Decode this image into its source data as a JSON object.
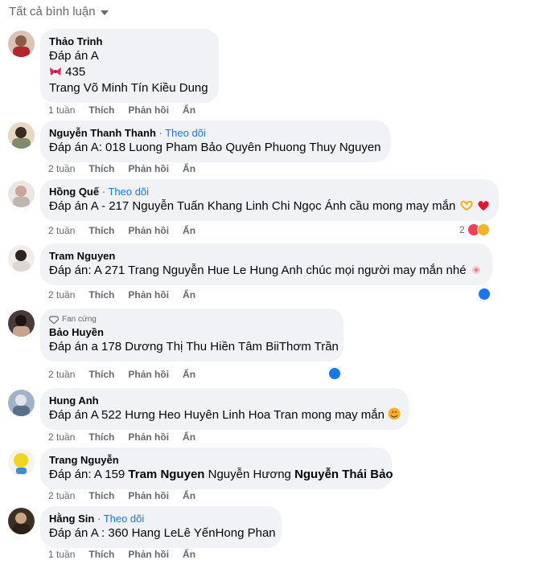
{
  "header": {
    "label": "Tất cả bình luận"
  },
  "actions": {
    "like": "Thích",
    "reply": "Phản hồi",
    "hide": "Ẩn"
  },
  "follow_label": "Theo dõi",
  "comments": [
    {
      "name": "Thảo Trinh",
      "lines": [
        "Đáp án A",
        "435",
        "Trang Võ Minh Tín Kiều Dung"
      ],
      "time": "1 tuần"
    },
    {
      "name": "Nguyễn Thanh Thanh",
      "lines": [
        "Đáp án A: 018",
        "Luong Pham Bảo Quyên Phuong Thuy Nguyen"
      ],
      "time": "2 tuần"
    },
    {
      "name": "Hồng Quế",
      "lines": [
        "Đáp án A - 217",
        "Nguyễn Tuấn Khang Linh Chi Ngọc Ánh",
        "cầu mong may mắn"
      ],
      "time": "2 tuần",
      "reaction_count": "2"
    },
    {
      "name": "Tram Nguyen",
      "lines": [
        "Đáp án: A 271",
        "Trang Nguyễn Hue Le Hung Anh",
        "chúc mọi người may mắn nhé"
      ],
      "time": "2 tuần"
    },
    {
      "badge": "Fan cứng",
      "name": "Bảo Huyền",
      "lines": [
        "Đáp án a 178 Dương Thị Thu Hiền Tâm BiiThơm Trần"
      ],
      "time": "2 tuần"
    },
    {
      "name": "Hung Anh",
      "lines": [
        "Đáp án A 522",
        "Hưng Heo Huyên Linh Hoa Tran",
        "mong may mắn"
      ],
      "time": "2 tuần"
    },
    {
      "name": "Trang Nguyễn",
      "lines": [
        "Đáp án: A 159",
        "Tram Nguyen",
        "Nguyễn Hương",
        "Nguyễn Thái Bảo"
      ],
      "time": "2 tuần"
    },
    {
      "name": "Hằng Sin",
      "lines": [
        "Đáp án A : 360 Hang LeLê YếnHong Phan"
      ],
      "time": "1 tuần"
    }
  ],
  "icons": {
    "dropdown": "caret-down-icon",
    "like": "like-icon",
    "heart": "heart-icon",
    "haha": "haha-icon",
    "diamond": "diamond-icon"
  }
}
